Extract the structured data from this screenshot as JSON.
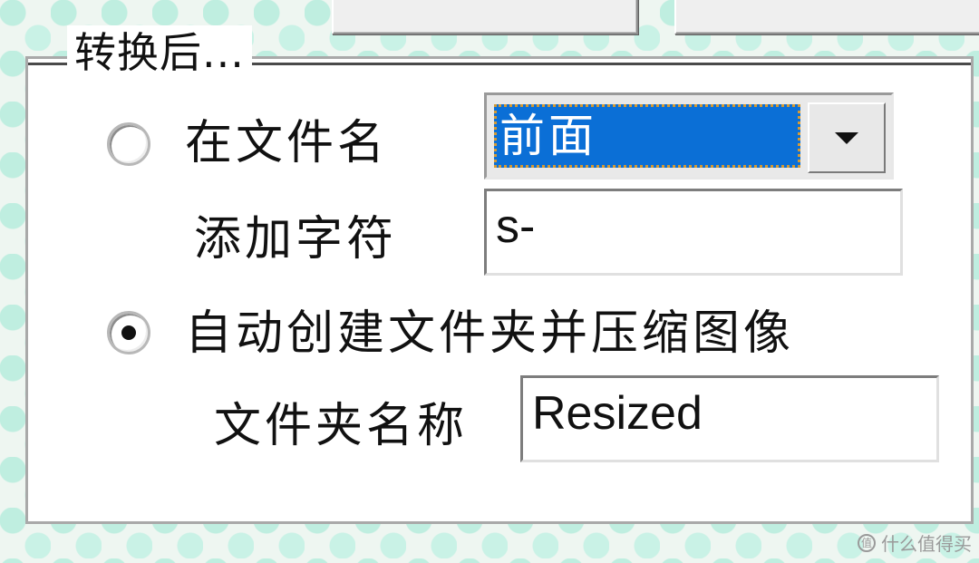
{
  "group": {
    "title": "转换后..."
  },
  "option_rename": {
    "label": "在文件名",
    "selected": false
  },
  "position_combo": {
    "value": "前面",
    "icon": "chevron-down-icon"
  },
  "add_chars": {
    "label": "添加字符",
    "value": "s-"
  },
  "option_folder": {
    "label": "自动创建文件夹并压缩图像",
    "selected": true
  },
  "folder_name": {
    "label": "文件夹名称",
    "value": "Resized"
  },
  "watermark": {
    "text": "什么值得买"
  },
  "colors": {
    "selection": "#0b6fd6",
    "focus_outline": "#d59a33",
    "background_pattern": "#bfeee0"
  }
}
